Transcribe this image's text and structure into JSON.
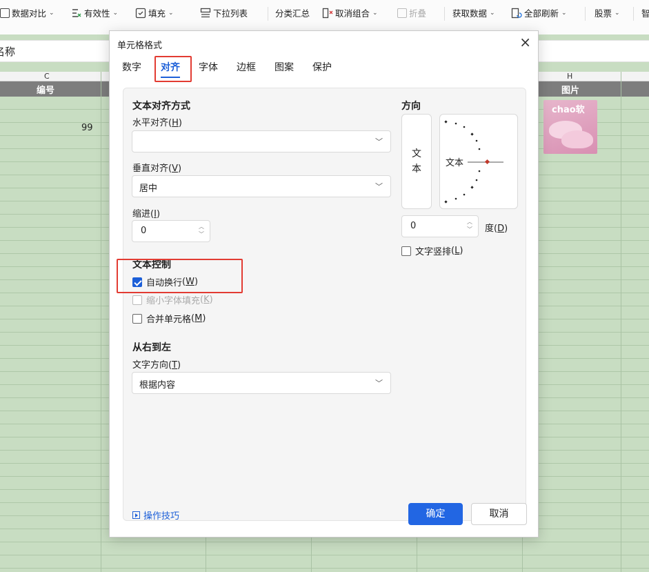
{
  "toolbar": {
    "items": [
      {
        "label": "数据对比",
        "caret": "⌄"
      },
      {
        "label": "有效性",
        "caret": "⌄"
      },
      {
        "label": "填充",
        "caret": "⌄"
      },
      {
        "label": "下拉列表",
        "caret": ""
      },
      {
        "label": "分类汇总",
        "caret": ""
      },
      {
        "label": "取消组合",
        "caret": "⌄"
      },
      {
        "label": "折叠",
        "caret": ""
      },
      {
        "label": "获取数据",
        "caret": "⌄"
      },
      {
        "label": "全部刷新",
        "caret": "⌄"
      },
      {
        "label": "股票",
        "caret": "⌄"
      },
      {
        "label": "智",
        "caret": ""
      }
    ]
  },
  "namebar": {
    "text": "名称"
  },
  "sheet": {
    "col_c": "C",
    "col_h": "H",
    "header_c": "编号",
    "header_h": "图片",
    "cell_c_value": "99",
    "thumb_brand": "chao软"
  },
  "dialog": {
    "title": "单元格格式",
    "close": "×",
    "tabs": [
      "数字",
      "对齐",
      "字体",
      "边框",
      "图案",
      "保护"
    ],
    "active_tab": "对齐",
    "text_align": {
      "section": "文本对齐方式",
      "horizontal_label": "水平对齐",
      "horizontal_key": "H",
      "horizontal_value": "",
      "vertical_label": "垂直对齐",
      "vertical_key": "V",
      "vertical_value": "居中",
      "indent_label": "缩进",
      "indent_key": "I",
      "indent_value": "0"
    },
    "orientation": {
      "section": "方向",
      "vertical_text_1": "文",
      "vertical_text_2": "本",
      "dial_text": "文本",
      "degree_value": "0",
      "degree_label": "度",
      "degree_key": "D",
      "stack_label": "文字竖排",
      "stack_key": "L"
    },
    "text_control": {
      "section": "文本控制",
      "wrap_label": "自动换行",
      "wrap_key": "W",
      "wrap_checked": true,
      "shrink_label": "缩小字体填充",
      "shrink_key": "K",
      "merge_label": "合并单元格",
      "merge_key": "M"
    },
    "rtl": {
      "section": "从右到左",
      "direction_label": "文字方向",
      "direction_key": "T",
      "direction_value": "根据内容"
    },
    "tips_label": "操作技巧",
    "ok_label": "确定",
    "cancel_label": "取消"
  },
  "colors": {
    "accent": "#2266e3",
    "highlight": "#e23b32",
    "sheet_bg": "#c8ddc2"
  }
}
